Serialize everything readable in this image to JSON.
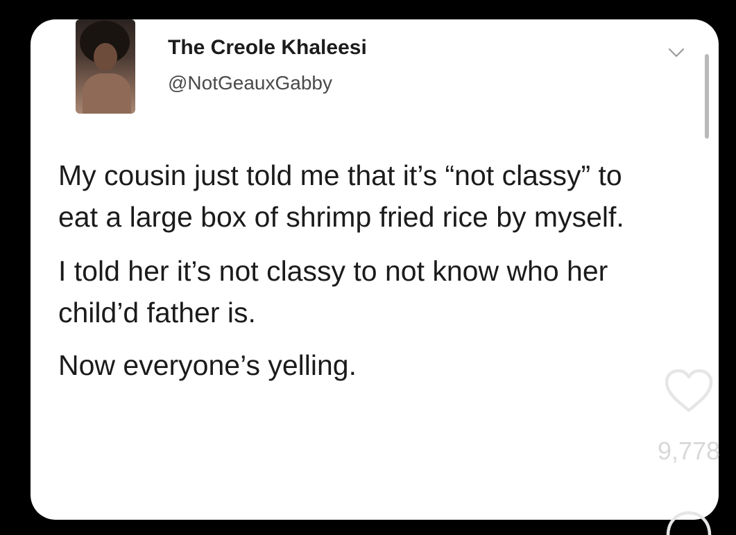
{
  "tweet": {
    "display_name": "The Creole Khaleesi",
    "handle": "@NotGeauxGabby",
    "avatar_icon": "profile-photo",
    "menu_icon": "chevron-down-icon",
    "paragraphs": [
      "My cousin just told me that it’s “not classy” to eat a large box of shrimp fried rice by myself.",
      "I told her it’s not classy to not know who her child’d father is.",
      "Now everyone’s yelling."
    ]
  },
  "overlay": {
    "like_icon": "heart-icon",
    "like_count": "9,778",
    "comment_icon": "comment-icon"
  },
  "colors": {
    "background": "#000000",
    "card": "#ffffff",
    "text": "#1b1b1b",
    "handle_text": "#4a4a4a",
    "overlay_icon": "#e6e6e6"
  }
}
